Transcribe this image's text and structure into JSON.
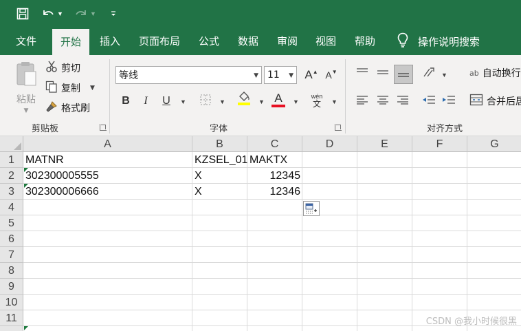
{
  "colors": {
    "brand": "#217346",
    "ribbon_bg": "#f3f2f1",
    "header_bg": "#e6e6e6",
    "error_indicator": "#1e7a3e",
    "font_color_bar": "#e81123",
    "fill_color_bar": "#ffff00"
  },
  "qat": {
    "save_icon": "save-icon",
    "undo_icon": "undo-icon",
    "redo_icon": "redo-icon",
    "customize_icon": "customize-qat-icon"
  },
  "tabs": [
    {
      "label": "文件"
    },
    {
      "label": "开始",
      "active": true
    },
    {
      "label": "插入"
    },
    {
      "label": "页面布局"
    },
    {
      "label": "公式"
    },
    {
      "label": "数据"
    },
    {
      "label": "审阅"
    },
    {
      "label": "视图"
    },
    {
      "label": "帮助"
    }
  ],
  "tell_me": {
    "label": "操作说明搜索",
    "icon": "lightbulb-icon"
  },
  "ribbon": {
    "clipboard": {
      "group_label": "剪贴板",
      "paste_label": "粘贴",
      "cut_label": "剪切",
      "copy_label": "复制",
      "format_painter_label": "格式刷"
    },
    "font": {
      "group_label": "字体",
      "font_name": "等线",
      "font_size": "11",
      "grow_label": "A",
      "shrink_label": "A",
      "bold": "B",
      "italic": "I",
      "underline": "U",
      "font_color_letter": "A",
      "phonetic_top": "wén",
      "phonetic_bottom": "文"
    },
    "alignment": {
      "group_label": "对齐方式",
      "wrap_text_label": "自动换行",
      "merge_label": "合并后居中",
      "wrap_icon_text": "ab"
    }
  },
  "sheet": {
    "columns": [
      "A",
      "B",
      "C",
      "D",
      "E",
      "F",
      "G"
    ],
    "rows": [
      "1",
      "2",
      "3",
      "4",
      "5",
      "6",
      "7",
      "8",
      "9",
      "10",
      "11"
    ],
    "cells": {
      "A1": "MATNR",
      "B1": "KZSEL_01",
      "C1": "MAKTX",
      "A2": "302300005555",
      "B2": "X",
      "C2": "12345",
      "A3": "302300006666",
      "B3": "X",
      "C3": "12346"
    }
  },
  "watermark": "CSDN @我小时候很黑"
}
